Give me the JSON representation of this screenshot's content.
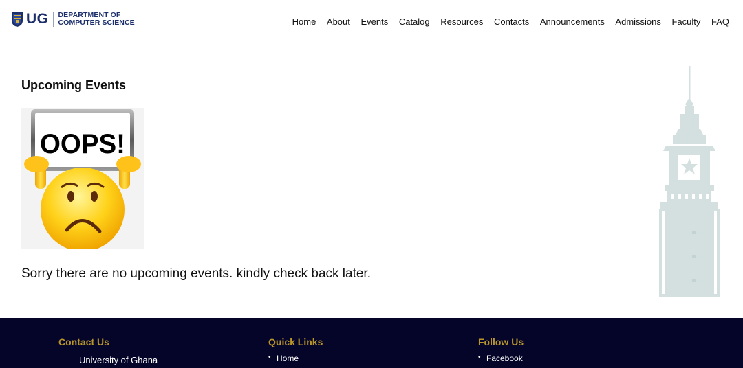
{
  "header": {
    "logo_short": "UG",
    "logo_line1": "DEPARTMENT OF",
    "logo_line2": "COMPUTER SCIENCE",
    "nav": [
      "Home",
      "About",
      "Events",
      "Catalog",
      "Resources",
      "Contacts",
      "Announcements",
      "Admissions",
      "Faculty",
      "FAQ"
    ]
  },
  "main": {
    "title": "Upcoming Events",
    "oops_text": "OOPS!",
    "message": "Sorry there are no upcoming events. kindly check back later."
  },
  "footer": {
    "contact": {
      "heading": "Contact Us",
      "address_line": "University of Ghana"
    },
    "quick_links": {
      "heading": "Quick Links",
      "items": [
        "Home"
      ]
    },
    "follow": {
      "heading": "Follow Us",
      "items": [
        "Facebook"
      ]
    }
  },
  "colors": {
    "brand_navy": "#1c2f6b",
    "footer_bg": "#05052a",
    "footer_heading": "#b8962a",
    "tower_tint": "#d4e0e0"
  },
  "icons": [
    "ug-crest-icon",
    "oops-emoji-image",
    "clock-tower-watermark"
  ]
}
